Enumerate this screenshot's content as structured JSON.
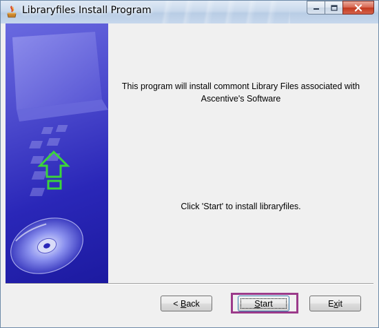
{
  "window": {
    "title": "Libraryfiles Install Program",
    "icon": "installer-icon"
  },
  "caption_buttons": {
    "minimize_icon": "minimize-icon",
    "maximize_icon": "maximize-icon",
    "close_icon": "close-icon"
  },
  "content": {
    "info_text": "This program will install commont Library Files associated with Ascentive's Software",
    "start_hint": "Click 'Start' to install libraryfiles."
  },
  "buttons": {
    "back": {
      "prefix": "< ",
      "mnemonic": "B",
      "rest": "ack"
    },
    "start": {
      "mnemonic": "S",
      "rest": "tart"
    },
    "exit": {
      "prefix": "E",
      "mnemonic": "x",
      "rest": "it"
    }
  },
  "colors": {
    "side_panel": "#2a27b8",
    "arrow": "#3bd43b",
    "highlight": "#9b3a8a",
    "close_button": "#c2391f"
  }
}
